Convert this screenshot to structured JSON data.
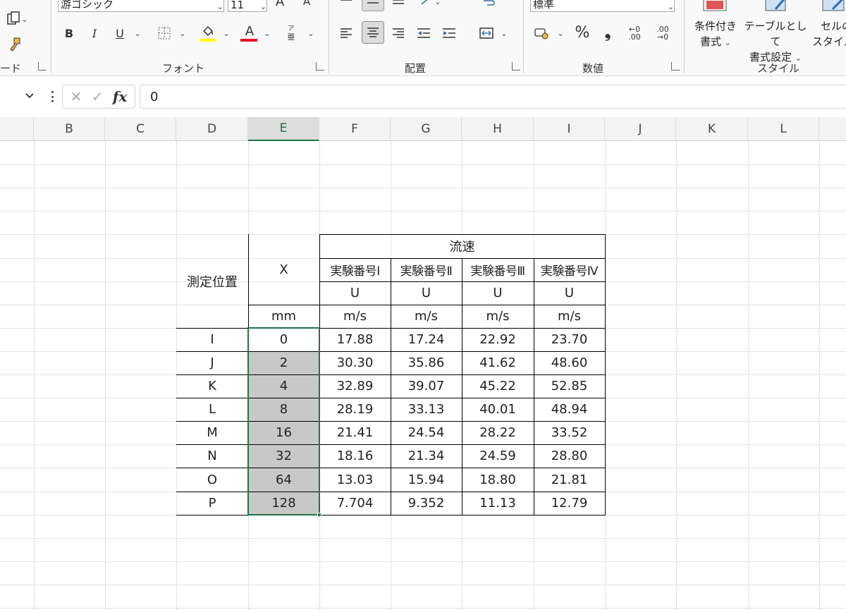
{
  "ribbon": {
    "font_name": "游ゴシック",
    "font_size": "11",
    "grow_font": "A",
    "shrink_font": "A",
    "bold": "B",
    "italic": "I",
    "underline": "U",
    "font_color_letter": "A",
    "phonetic_top": "ア",
    "phonetic_bottom": "亜",
    "number_format": "標準",
    "percent": "%",
    "comma": "❟",
    "inc_decimal": "←0 .00",
    "dec_decimal": ".00 →0",
    "group_clipboard_fragment": "ード",
    "group_font": "フォント",
    "group_alignment": "配置",
    "group_number": "数値",
    "group_styles": "スタイル",
    "cond_format_line1": "条件付き",
    "cond_format_line2": "書式",
    "table_format_line1": "テーブルとして",
    "table_format_line2": "書式設定",
    "cell_styles_line1": "セルの",
    "cell_styles_line2": "スタイル",
    "fill_color": "#ffff00",
    "font_color": "#e81123"
  },
  "formula_bar": {
    "cancel": "✕",
    "enter": "✓",
    "fx": "fx",
    "value": "0"
  },
  "columns": [
    "B",
    "C",
    "D",
    "E",
    "F",
    "G",
    "H",
    "I",
    "J",
    "K",
    "L"
  ],
  "selected_column": "E",
  "table": {
    "header_measure_pos": "測定位置",
    "header_x": "X",
    "header_velocity": "流速",
    "experiments": [
      "実験番号Ⅰ",
      "実験番号Ⅱ",
      "実験番号Ⅲ",
      "実験番号Ⅳ"
    ],
    "var_u": "U",
    "unit_x": "mm",
    "unit_u": "m/s",
    "rows": [
      {
        "pos": "I",
        "x": "0",
        "v": [
          "17.88",
          "17.24",
          "22.92",
          "23.70"
        ]
      },
      {
        "pos": "J",
        "x": "2",
        "v": [
          "30.30",
          "35.86",
          "41.62",
          "48.60"
        ]
      },
      {
        "pos": "K",
        "x": "4",
        "v": [
          "32.89",
          "39.07",
          "45.22",
          "52.85"
        ]
      },
      {
        "pos": "L",
        "x": "8",
        "v": [
          "28.19",
          "33.13",
          "40.01",
          "48.94"
        ]
      },
      {
        "pos": "M",
        "x": "16",
        "v": [
          "21.41",
          "24.54",
          "28.22",
          "33.52"
        ]
      },
      {
        "pos": "N",
        "x": "32",
        "v": [
          "18.16",
          "21.34",
          "24.59",
          "28.80"
        ]
      },
      {
        "pos": "O",
        "x": "64",
        "v": [
          "13.03",
          "15.94",
          "18.80",
          "21.81"
        ]
      },
      {
        "pos": "P",
        "x": "128",
        "v": [
          "7.704",
          "9.352",
          "11.13",
          "12.79"
        ]
      }
    ]
  },
  "colors": {
    "accent": "#217346",
    "selection_fill": "#c8c8c8"
  }
}
